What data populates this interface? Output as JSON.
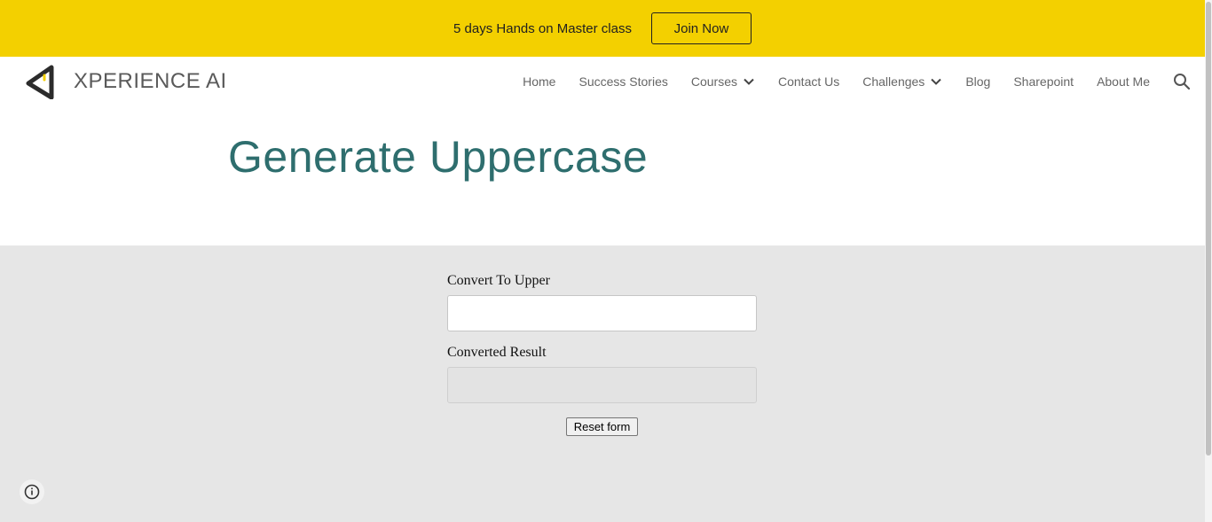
{
  "announcement": {
    "text": "5 days Hands on Master class",
    "button_label": "Join Now",
    "background": "#f3d000"
  },
  "header": {
    "site_title": "XPERIENCE AI",
    "logo_icon": "triangle-logo-icon",
    "nav": [
      {
        "label": "Home",
        "has_dropdown": false
      },
      {
        "label": "Success Stories",
        "has_dropdown": false
      },
      {
        "label": "Courses",
        "has_dropdown": true
      },
      {
        "label": "Contact Us",
        "has_dropdown": false
      },
      {
        "label": "Challenges",
        "has_dropdown": true
      },
      {
        "label": "Blog",
        "has_dropdown": false
      },
      {
        "label": "Sharepoint",
        "has_dropdown": false
      },
      {
        "label": "About Me",
        "has_dropdown": false
      }
    ],
    "search_icon": "search-icon"
  },
  "main": {
    "title": "Generate Uppercase",
    "title_color": "#2e6e6e"
  },
  "form": {
    "input_label": "Convert To Upper",
    "input_value": "",
    "result_label": "Converted Result",
    "result_value": "",
    "reset_label": "Reset form",
    "background": "#e6e6e6"
  },
  "footer": {
    "info_icon": "info-icon"
  }
}
